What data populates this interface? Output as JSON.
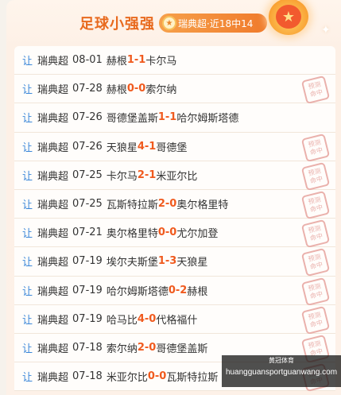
{
  "header": {
    "title": "足球小强强",
    "badge": "瑞典超·近18中14"
  },
  "rows": [
    {
      "prefix": "让",
      "league": "瑞典超",
      "date": "08-01",
      "home": "赫根",
      "hs": "1",
      "sep": " - ",
      "as": "1",
      "away": "卡尔马",
      "hit": false
    },
    {
      "prefix": "让",
      "league": "瑞典超",
      "date": "07-28",
      "home": "赫根",
      "hs": "0",
      "sep": " - ",
      "as": "0",
      "away": "索尔纳",
      "hit": true
    },
    {
      "prefix": "让",
      "league": "瑞典超",
      "date": "07-26",
      "home": "哥德堡盖斯",
      "hs": "1",
      "sep": " - ",
      "as": "1",
      "away": "哈尔姆斯塔德",
      "hit": false
    },
    {
      "prefix": "让",
      "league": "瑞典超",
      "date": "07-26",
      "home": "天狼星",
      "hs": "4",
      "sep": " - ",
      "as": "1",
      "away": "哥德堡",
      "hit": true
    },
    {
      "prefix": "让",
      "league": "瑞典超",
      "date": "07-25",
      "home": "卡尔马",
      "hs": "2",
      "sep": " - ",
      "as": "1",
      "away": "米亚尔比",
      "hit": true
    },
    {
      "prefix": "让",
      "league": "瑞典超",
      "date": "07-25",
      "home": "瓦斯特拉斯",
      "hs": "2",
      "sep": " - ",
      "as": "0",
      "away": "奥尔格里特",
      "hit": true
    },
    {
      "prefix": "让",
      "league": "瑞典超",
      "date": "07-21",
      "home": "奥尔格里特",
      "hs": "0",
      "sep": " - ",
      "as": "0",
      "away": "尤尔加登",
      "hit": true
    },
    {
      "prefix": "让",
      "league": "瑞典超",
      "date": "07-19",
      "home": "埃尔夫斯堡",
      "hs": "1",
      "sep": " - ",
      "as": "3",
      "away": "天狼星",
      "hit": true
    },
    {
      "prefix": "让",
      "league": "瑞典超",
      "date": "07-19",
      "home": "哈尔姆斯塔德",
      "hs": "0",
      "sep": " - ",
      "as": "2",
      "away": "赫根",
      "hit": true
    },
    {
      "prefix": "让",
      "league": "瑞典超",
      "date": "07-19",
      "home": "哈马比",
      "hs": "4",
      "sep": " - ",
      "as": "0",
      "away": "代格福什",
      "hit": true
    },
    {
      "prefix": "让",
      "league": "瑞典超",
      "date": "07-18",
      "home": "索尔纳",
      "hs": "2",
      "sep": " - ",
      "as": "0",
      "away": "哥德堡盖斯",
      "hit": true
    },
    {
      "prefix": "让",
      "league": "瑞典超",
      "date": "07-18",
      "home": "米亚尔比",
      "hs": "0",
      "sep": " - ",
      "as": "0",
      "away": "瓦斯特拉斯",
      "hit": true
    }
  ],
  "stamp_text": [
    "预测",
    "命中"
  ],
  "watermark": {
    "top": "黄冠体育",
    "url": "huangguansportguanwang.com"
  }
}
